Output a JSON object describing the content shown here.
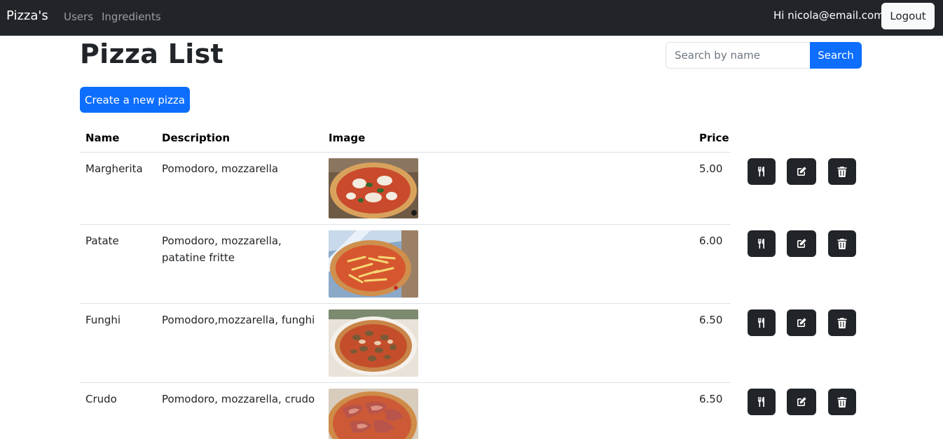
{
  "navbar": {
    "brand": "Pizza's",
    "links": [
      "Users",
      "Ingredients"
    ],
    "greeting": "Hi nicola@email.com",
    "logout_label": "Logout"
  },
  "page": {
    "title": "Pizza List",
    "search_placeholder": "Search by name",
    "search_label": "Search",
    "create_label": "Create a new pizza"
  },
  "table": {
    "headers": [
      "Name",
      "Description",
      "Image",
      "Price"
    ],
    "rows": [
      {
        "name": "Margherita",
        "description": "Pomodoro, mozzarella",
        "price": "5.00"
      },
      {
        "name": "Patate",
        "description": "Pomodoro, mozzarella, patatine fritte",
        "price": "6.00"
      },
      {
        "name": "Funghi",
        "description": "Pomodoro,mozzarella, funghi",
        "price": "6.50"
      },
      {
        "name": "Crudo",
        "description": "Pomodoro, mozzarella, crudo",
        "price": "6.50"
      }
    ],
    "row_actions": [
      "utensils-icon",
      "edit-icon",
      "trash-icon"
    ]
  },
  "colors": {
    "navbar": "#212529",
    "primary": "#0d6efd",
    "action_button": "#212529"
  }
}
